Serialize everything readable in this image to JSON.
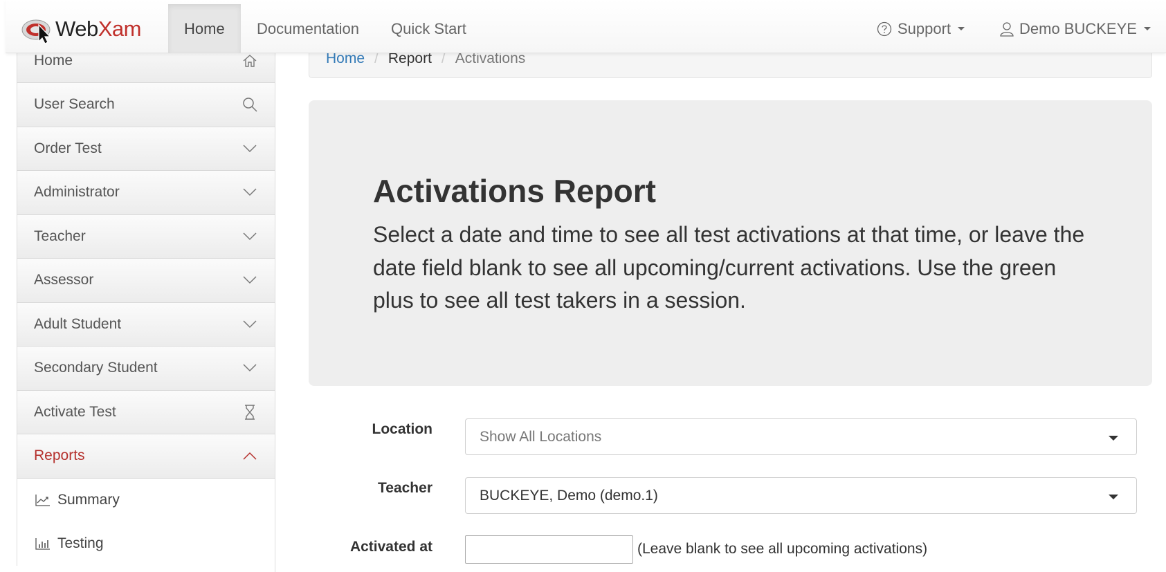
{
  "brand": {
    "name_part1": "Web",
    "name_part2": "Xam"
  },
  "nav": {
    "tabs": [
      {
        "label": "Home"
      },
      {
        "label": "Documentation"
      },
      {
        "label": "Quick Start"
      }
    ],
    "support_label": "Support",
    "user_label": "Demo BUCKEYE"
  },
  "sidebar": {
    "items": [
      {
        "label": "Home",
        "icon": "home-icon"
      },
      {
        "label": "User Search",
        "icon": "search-icon"
      },
      {
        "label": "Order Test",
        "icon": "chevron-down-icon"
      },
      {
        "label": "Administrator",
        "icon": "chevron-down-icon"
      },
      {
        "label": "Teacher",
        "icon": "chevron-down-icon"
      },
      {
        "label": "Assessor",
        "icon": "chevron-down-icon"
      },
      {
        "label": "Adult Student",
        "icon": "chevron-down-icon"
      },
      {
        "label": "Secondary Student",
        "icon": "chevron-down-icon"
      },
      {
        "label": "Activate Test",
        "icon": "hourglass-icon"
      },
      {
        "label": "Reports",
        "icon": "chevron-up-icon"
      }
    ],
    "sub_items": [
      {
        "label": "Summary",
        "icon": "line-chart-icon"
      },
      {
        "label": "Testing",
        "icon": "bar-chart-icon"
      }
    ]
  },
  "breadcrumb": {
    "home": "Home",
    "report": "Report",
    "current": "Activations"
  },
  "jumbotron": {
    "title": "Activations Report",
    "description": "Select a date and time to see all test activations at that time, or leave the date field blank to see all upcoming/current activations. Use the green plus to see all test takers in a session."
  },
  "form": {
    "location_label": "Location",
    "location_value": "Show All Locations",
    "teacher_label": "Teacher",
    "teacher_value": "BUCKEYE, Demo (demo.1)",
    "activated_label": "Activated at",
    "activated_value": "",
    "activated_hint": "(Leave blank to see all upcoming activations)"
  },
  "colors": {
    "accent_red": "#b5302c",
    "link_blue": "#337ab7"
  }
}
